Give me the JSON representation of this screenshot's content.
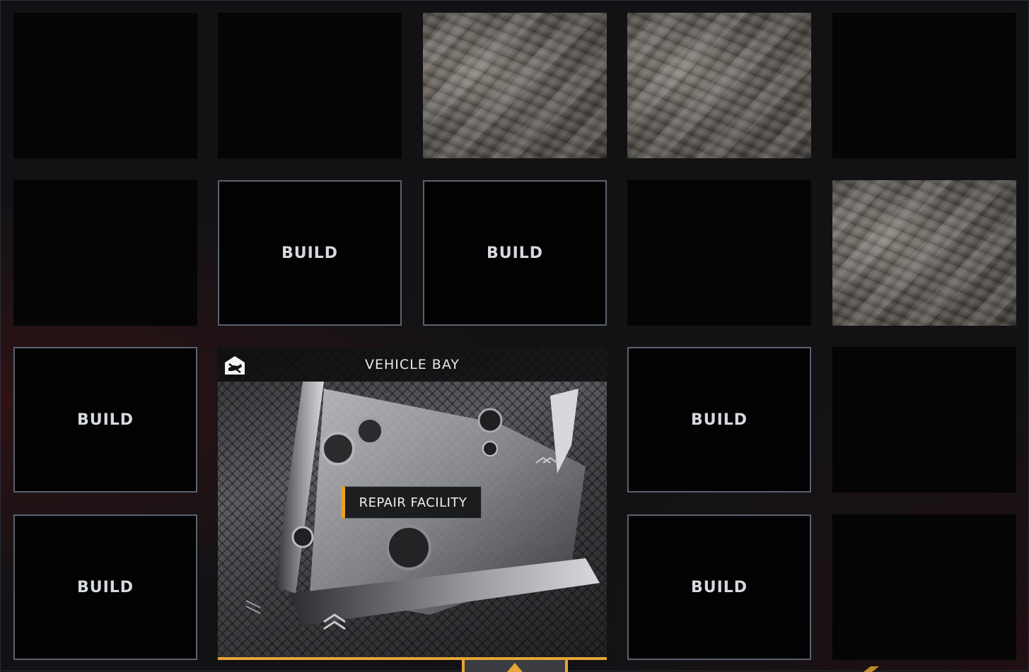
{
  "grid": {
    "build_label": "BUILD"
  },
  "facility": {
    "title": "VEHICLE BAY",
    "label": "REPAIR FACILITY",
    "icon": "vehicle-bay-icon"
  },
  "colors": {
    "accent": "#e8a637",
    "tile_border": "#5b6270",
    "background": "#121214"
  }
}
